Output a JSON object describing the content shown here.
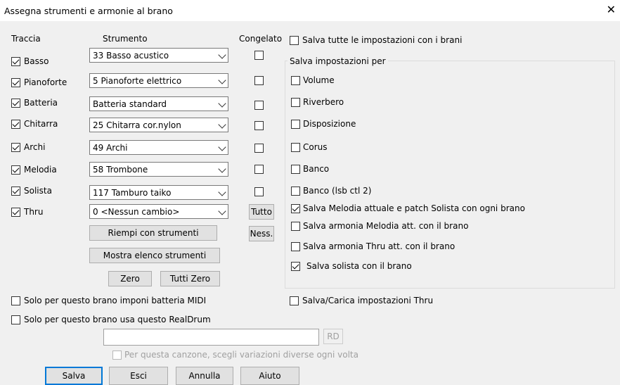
{
  "dialog": {
    "title": "Assegna strumenti e armonie al brano",
    "close_glyph": "✕"
  },
  "headers": {
    "track": "Traccia",
    "instrument": "Strumento",
    "frozen": "Congelato"
  },
  "tracks": [
    {
      "label": "Basso",
      "checked": true,
      "instrument": "33 Basso acustico",
      "frozen": false
    },
    {
      "label": "Pianoforte",
      "checked": true,
      "instrument": "5 Pianoforte elettrico",
      "frozen": false
    },
    {
      "label": "Batteria",
      "checked": true,
      "instrument": "Batteria standard",
      "frozen": false
    },
    {
      "label": "Chitarra",
      "checked": true,
      "instrument": "25 Chitarra cor.nylon",
      "frozen": false
    },
    {
      "label": "Archi",
      "checked": true,
      "instrument": "49 Archi",
      "frozen": false
    },
    {
      "label": "Melodia",
      "checked": true,
      "instrument": "58 Trombone",
      "frozen": false
    },
    {
      "label": "Solista",
      "checked": true,
      "instrument": "117 Tamburo taiko",
      "frozen": false
    },
    {
      "label": "Thru",
      "checked": true,
      "instrument": "0 <Nessun cambio>"
    }
  ],
  "buttons": {
    "all": "Tutto",
    "none": "Ness.",
    "fill": "Riempi con strumenti",
    "show_list": "Mostra elenco strumenti",
    "zero": "Zero",
    "all_zero": "Tutti Zero",
    "rd": "RD",
    "save": "Salva",
    "exit": "Esci",
    "cancel": "Annulla",
    "help": "Aiuto"
  },
  "save_all": {
    "label": "Salva tutte le impostazioni con i brani",
    "checked": false
  },
  "group": {
    "label": "Salva impostazioni per",
    "items": [
      {
        "label": "Volume",
        "checked": false
      },
      {
        "label": "Riverbero",
        "checked": false
      },
      {
        "label": "Disposizione",
        "checked": false
      },
      {
        "label": "Corus",
        "checked": false
      },
      {
        "label": "Banco",
        "checked": false
      },
      {
        "label": "Banco (lsb ctl 2)",
        "checked": false
      },
      {
        "label": "Salva Melodia attuale e patch Solista con ogni brano",
        "checked": true
      },
      {
        "label": "Salva armonia Melodia att. con il brano",
        "checked": false
      },
      {
        "label": "Salva armonia Thru att. con il brano",
        "checked": false
      },
      {
        "label": "Salva solista con il brano",
        "checked": true
      }
    ]
  },
  "options": {
    "midi_drums": {
      "label": "Solo per questo brano imponi batteria MIDI",
      "checked": false
    },
    "realdrums": {
      "label": "Solo per questo brano usa questo RealDrum",
      "checked": false
    },
    "realdrums_value": "",
    "variations": {
      "label": "Per questa canzone, scegli variazioni diverse ogni volta",
      "checked": false
    },
    "thru_settings": {
      "label": "Salva/Carica impostazioni Thru",
      "checked": false
    }
  }
}
